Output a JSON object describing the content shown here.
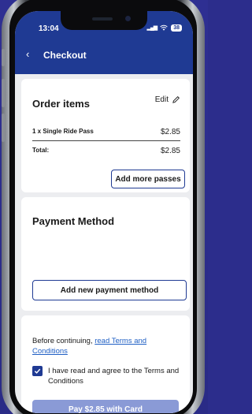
{
  "status": {
    "time": "13:04",
    "battery": "38"
  },
  "header": {
    "title": "Checkout"
  },
  "order": {
    "heading": "Order items",
    "edit_label": "Edit",
    "item_label": "1 x Single Ride Pass",
    "item_price": "$2.85",
    "total_label": "Total:",
    "total_price": "$2.85",
    "add_more_label": "Add more passes"
  },
  "payment": {
    "heading": "Payment Method",
    "add_method_label": "Add new payment method"
  },
  "terms": {
    "notice_prefix": "Before continuing,",
    "notice_link": "read Terms and Conditions",
    "agree_label": "I have read and agree to the Terms and Conditions",
    "agree_checked": true,
    "pay_label": "Pay $2.85 with Card"
  },
  "colors": {
    "brand": "#1f3a93",
    "disabled_button": "#8a9ad6",
    "link": "#1f5fc4",
    "background": "#ecedf0"
  }
}
